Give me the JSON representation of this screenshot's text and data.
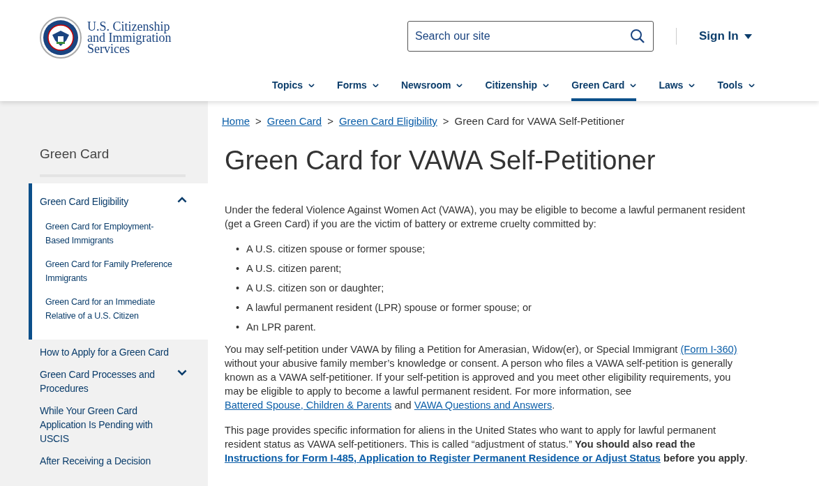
{
  "header": {
    "agency_name": [
      "U.S. Citizenship",
      "and Immigration",
      "Services"
    ],
    "search": {
      "placeholder": "Search our site"
    },
    "sign_in": "Sign In"
  },
  "nav": [
    {
      "label": "Topics",
      "selected": false
    },
    {
      "label": "Forms",
      "selected": false
    },
    {
      "label": "Newsroom",
      "selected": false
    },
    {
      "label": "Citizenship",
      "selected": false
    },
    {
      "label": "Green Card",
      "selected": true
    },
    {
      "label": "Laws",
      "selected": false
    },
    {
      "label": "Tools",
      "selected": false
    }
  ],
  "sidebar": {
    "title": "Green Card",
    "items": [
      {
        "label": "Green Card Eligibility",
        "expanded": true,
        "children": [
          {
            "label": "Green Card for Employment-Based Immigrants"
          },
          {
            "label": "Green Card for Family Preference Immigrants"
          },
          {
            "label": "Green Card for an Immediate Relative of a U.S. Citizen"
          }
        ]
      },
      {
        "label": "How to Apply for a Green Card"
      },
      {
        "label": "Green Card Processes and Procedures",
        "expanded": false
      },
      {
        "label": "While Your Green Card Application Is Pending with USCIS"
      },
      {
        "label": "After Receiving a Decision"
      }
    ]
  },
  "breadcrumb": [
    {
      "label": "Home",
      "kind": "link",
      "separator": ">"
    },
    {
      "label": "Green Card",
      "kind": "link",
      "separator": ">"
    },
    {
      "label": "Green Card Eligibility",
      "kind": "link",
      "separator": ">"
    },
    {
      "label": "Green Card for VAWA Self-Petitioner",
      "kind": "current"
    }
  ],
  "title": "Green Card for VAWA Self-Petitioner",
  "intro": "Under the federal Violence Against Women Act (VAWA), you may be eligible to become a lawful permanent resident (get a Green Card) if you are the victim of battery or extreme cruelty committed by:",
  "list": [
    {
      "marker": "•",
      "text": "A U.S. citizen spouse or former spouse;"
    },
    {
      "marker": "•",
      "text": "A U.S. citizen parent;"
    },
    {
      "marker": "•",
      "text": "A U.S. citizen son or daughter;"
    },
    {
      "marker": "•",
      "text": "A lawful permanent resident (LPR) spouse or former spouse; or"
    },
    {
      "marker": "•",
      "text": "An LPR parent."
    }
  ],
  "paragraphs": [
    {
      "parts": [
        {
          "kind": "text",
          "text": "You may self-petition under VAWA by filing a Petition for Amerasian, Widow(er), or Special Immigrant "
        },
        {
          "kind": "link",
          "text": "(Form I-360)"
        },
        {
          "kind": "text",
          "text": " without your abusive family member’s knowledge or consent. A person who files a VAWA self-petition is generally known as a VAWA self-petitioner. If your self-petition is approved and you meet other eligibility requirements, you may be eligible to apply to become a lawful permanent resident. For more information, see "
        },
        {
          "kind": "link",
          "text": "Battered Spouse, Children & Parents"
        },
        {
          "kind": "text",
          "text": " and "
        },
        {
          "kind": "link",
          "text": "VAWA Questions and Answers"
        },
        {
          "kind": "text",
          "text": "."
        }
      ]
    },
    {
      "parts": [
        {
          "kind": "text",
          "text": "This page provides specific information for aliens in the United States who want to apply for lawful permanent resident status as VAWA self-petitioners. This is called “adjustment of status.” "
        },
        {
          "kind": "bold",
          "text": "You should also read the "
        },
        {
          "kind": "bold_link",
          "text": "Instructions for Form I-485, Application to Register Permanent Residence or Adjust Status"
        },
        {
          "kind": "bold",
          "text": " before you apply"
        },
        {
          "kind": "text",
          "text": "."
        }
      ]
    }
  ]
}
